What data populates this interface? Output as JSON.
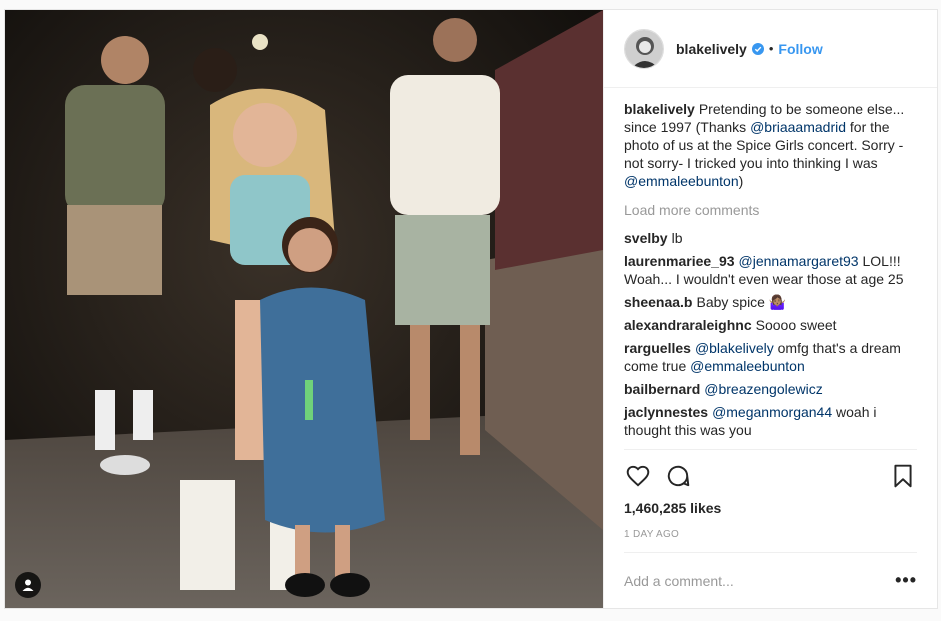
{
  "post": {
    "username": "blakelively",
    "verified": true,
    "follow_label": "Follow",
    "separator": "•",
    "photo_icon": "person-tag-icon"
  },
  "caption": {
    "username": "blakelively",
    "text_1": "Pretending to be someone else... since 1997 (Thanks ",
    "mention_1": "@briaaamadrid",
    "text_2": " for the photo of us at the Spice Girls concert. Sorry -not sorry- I tricked you into thinking I was ",
    "mention_2": "@emmaleebunton",
    "text_3": ")"
  },
  "load_more": "Load more comments",
  "comments": [
    {
      "user": "svelby",
      "pre": "",
      "mention": "",
      "post": "lb"
    },
    {
      "user": "laurenmariee_93",
      "pre": "",
      "mention": "@jennamargaret93",
      "post": " LOL!!! Woah... I wouldn't even wear those at age 25"
    },
    {
      "user": "sheenaa.b",
      "pre": "Baby spice ",
      "mention": "",
      "post": "🤷🏽‍♀️"
    },
    {
      "user": "alexandraraleighnc",
      "pre": "Soooo sweet",
      "mention": "",
      "post": ""
    },
    {
      "user": "rarguelles",
      "pre": "",
      "mention": "@blakelively",
      "post": " omfg that's a dream come true ",
      "mention2": "@emmaleebunton"
    },
    {
      "user": "bailbernard",
      "pre": "",
      "mention": "@breazengolewicz",
      "post": ""
    },
    {
      "user": "jaclynnestes",
      "pre": "",
      "mention": "@meganmorgan44",
      "post": " woah i thought this was you"
    }
  ],
  "likes": "1,460,285 likes",
  "age": "1 DAY AGO",
  "add_comment_placeholder": "Add a comment...",
  "more_label": "•••",
  "colors": {
    "link": "#3897f0",
    "mention": "#003569",
    "muted": "#999999"
  }
}
